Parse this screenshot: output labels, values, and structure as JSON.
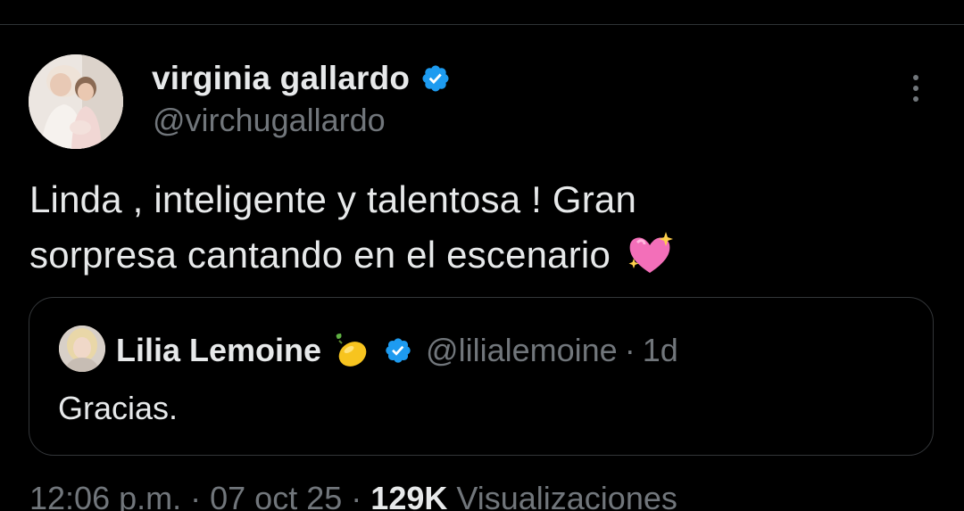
{
  "tweet": {
    "author": {
      "display_name": "virginia gallardo",
      "handle": "@virchugallardo",
      "verified": true
    },
    "text_line1": "Linda , inteligente y talentosa ! Gran",
    "text_line2": "sorpresa cantando en el escenario",
    "text_emoji": "sparkling-heart-icon"
  },
  "quote": {
    "display_name": "Lilia Lemoine",
    "name_emoji": "lemon-icon",
    "verified": true,
    "handle": "@lilialemoine",
    "separator": "·",
    "time": "1d",
    "text": "Gracias."
  },
  "meta": {
    "time": "12:06 p.m.",
    "sep1": "·",
    "date": "07 oct 25",
    "sep2": "·",
    "views": "129K",
    "views_label": "Visualizaciones"
  },
  "colors": {
    "background": "#000000",
    "primary_text": "#e7e9ea",
    "secondary_text": "#71767b",
    "verified_blue": "#1d9bf0",
    "border": "#2f3336"
  }
}
